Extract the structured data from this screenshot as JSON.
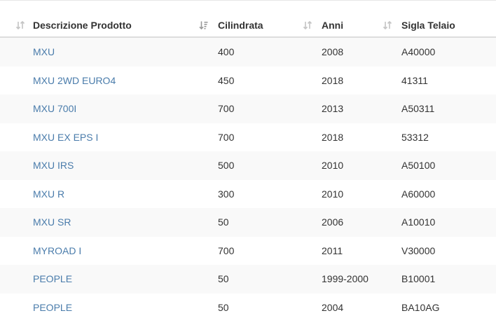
{
  "table": {
    "columns": [
      {
        "label": "Descrizione Prodotto",
        "sort_icon": "sort-both-icon"
      },
      {
        "label": "Cilindrata",
        "sort_icon": "sort-descending-icon"
      },
      {
        "label": "Anni",
        "sort_icon": "sort-both-icon"
      },
      {
        "label": "Sigla Telaio",
        "sort_icon": "sort-both-icon"
      }
    ],
    "rows": [
      {
        "desc": "MXU",
        "cil": "400",
        "anni": "2008",
        "sigla": "A40000"
      },
      {
        "desc": "MXU 2WD EURO4",
        "cil": "450",
        "anni": "2018",
        "sigla": "41311"
      },
      {
        "desc": "MXU 700I",
        "cil": "700",
        "anni": "2013",
        "sigla": "A50311"
      },
      {
        "desc": "MXU EX EPS I",
        "cil": "700",
        "anni": "2018",
        "sigla": "53312"
      },
      {
        "desc": "MXU IRS",
        "cil": "500",
        "anni": "2010",
        "sigla": "A50100"
      },
      {
        "desc": "MXU R",
        "cil": "300",
        "anni": "2010",
        "sigla": "A60000"
      },
      {
        "desc": "MXU SR",
        "cil": "50",
        "anni": "2006",
        "sigla": "A10010"
      },
      {
        "desc": "MYROAD I",
        "cil": "700",
        "anni": "2011",
        "sigla": "V30000"
      },
      {
        "desc": "PEOPLE",
        "cil": "50",
        "anni": "1999-2000",
        "sigla": "B10001"
      },
      {
        "desc": "PEOPLE",
        "cil": "50",
        "anni": "2004",
        "sigla": "BA10AG"
      }
    ]
  },
  "colors": {
    "link": "#4a7cab",
    "text": "#333333",
    "stripe": "#f9f9f9",
    "header_border": "#dddddd",
    "icon": "#c4c4c4"
  }
}
